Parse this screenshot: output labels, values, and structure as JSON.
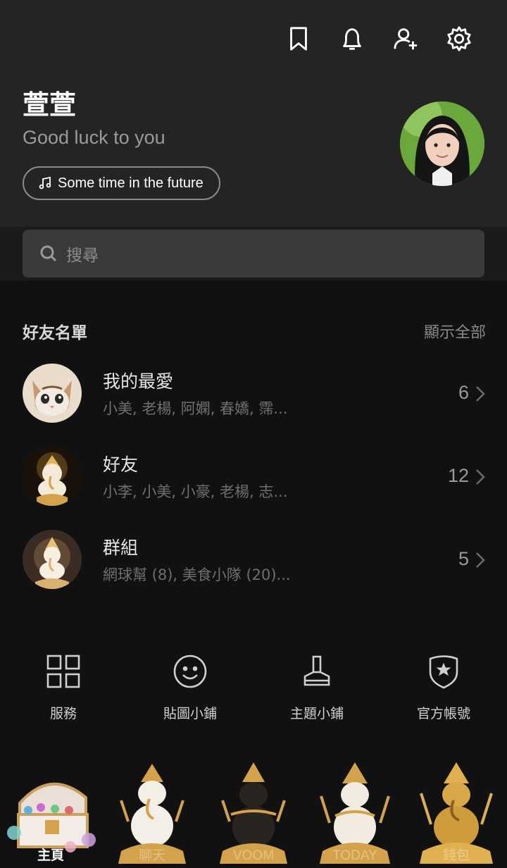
{
  "header": {
    "icons": [
      "bookmark-icon",
      "bell-icon",
      "add-friend-icon",
      "gear-icon"
    ],
    "name": "萱萱",
    "status": "Good luck to you",
    "music": "Some time in the future"
  },
  "search": {
    "placeholder": "搜尋"
  },
  "friends": {
    "title": "好友名單",
    "show_all": "顯示全部",
    "rows": [
      {
        "name": "我的最愛",
        "members": "小美, 老楊, 阿嫻, 春嬌, 霈...",
        "count": "6"
      },
      {
        "name": "好友",
        "members": "小李, 小美, 小豪, 老楊, 志...",
        "count": "12"
      },
      {
        "name": "群組",
        "members": "網球幫 (8), 美食小隊 (20)...",
        "count": "5"
      }
    ]
  },
  "services": [
    {
      "label": "服務",
      "icon": "grid-icon"
    },
    {
      "label": "貼圖小鋪",
      "icon": "smiley-icon"
    },
    {
      "label": "主題小鋪",
      "icon": "brush-icon"
    },
    {
      "label": "官方帳號",
      "icon": "shield-star-icon"
    }
  ],
  "bottom_nav": [
    {
      "label": "主頁",
      "active": true
    },
    {
      "label": "聊天"
    },
    {
      "label": "VOOM"
    },
    {
      "label": "TODAY"
    },
    {
      "label": "錢包"
    }
  ],
  "colors": {
    "header_bg": "#242424",
    "body_bg": "#111111",
    "gold": "#d4a24a"
  }
}
